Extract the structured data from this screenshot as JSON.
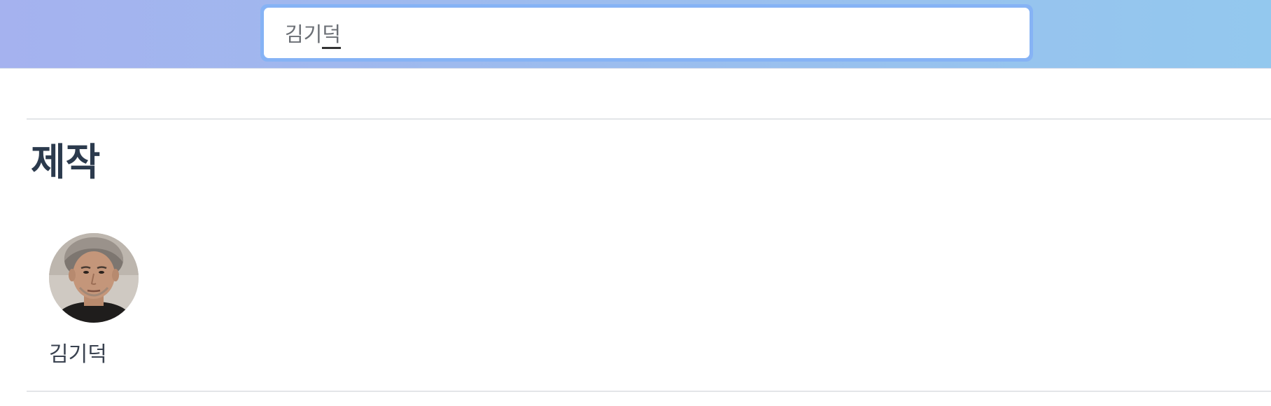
{
  "search": {
    "query_committed": "김기",
    "query_composing": "덕"
  },
  "section": {
    "title": "제작"
  },
  "people": [
    {
      "name": "김기덕",
      "avatar_icon": "person-photo"
    }
  ],
  "colors": {
    "topbar_start": "#a5b2ef",
    "topbar_end": "#93c8ee",
    "search_border": "#86b3f5",
    "title_text": "#2b3a4d"
  }
}
